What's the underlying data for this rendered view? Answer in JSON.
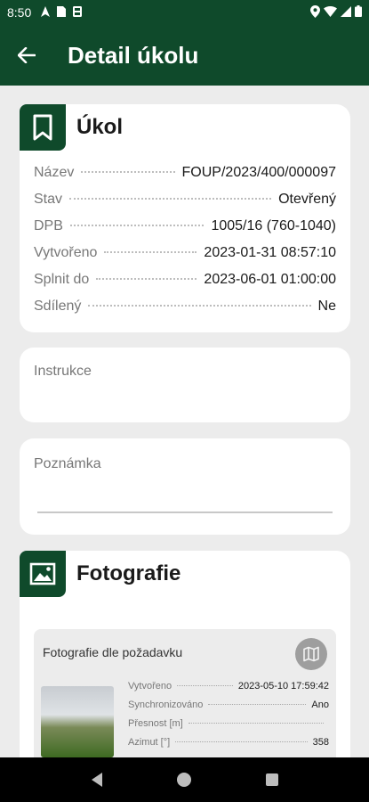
{
  "status_bar": {
    "time": "8:50",
    "icons_left": [
      "navigation-icon",
      "sim-card-icon",
      "sd-card-icon"
    ],
    "icons_right": [
      "location-icon",
      "wifi-icon",
      "signal-icon",
      "battery-icon"
    ]
  },
  "app_bar": {
    "title": "Detail úkolu"
  },
  "task_card": {
    "title": "Úkol",
    "rows": [
      {
        "label": "Název",
        "value": "FOUP/2023/400/000097"
      },
      {
        "label": "Stav",
        "value": "Otevřený"
      },
      {
        "label": "DPB",
        "value": "1005/16 (760-1040)"
      },
      {
        "label": "Vytvořeno",
        "value": "2023-01-31 08:57:10"
      },
      {
        "label": "Splnit do",
        "value": "2023-06-01 01:00:00"
      },
      {
        "label": "Sdílený",
        "value": "Ne"
      }
    ]
  },
  "instructions": {
    "label": "Instrukce"
  },
  "note": {
    "label": "Poznámka"
  },
  "photos": {
    "title": "Fotografie",
    "item": {
      "title": "Fotografie dle požadavku",
      "meta": [
        {
          "label": "Vytvořeno",
          "value": "2023-05-10 17:59:42"
        },
        {
          "label": "Synchronizováno",
          "value": "Ano"
        },
        {
          "label": "Přesnost [m]",
          "value": ""
        },
        {
          "label": "Azimut [°]",
          "value": "358"
        }
      ]
    }
  },
  "colors": {
    "primary": "#0f4a2b",
    "background": "#ececec",
    "card": "#ffffff"
  }
}
